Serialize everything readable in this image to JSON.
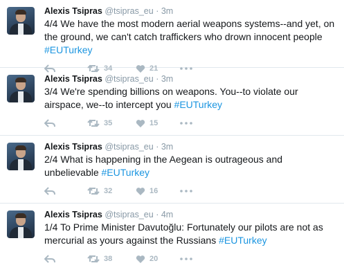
{
  "tweets": [
    {
      "name": "Alexis Tsipras",
      "handle": "@tsipras_eu",
      "separator": "·",
      "time": "3m",
      "text": "4/4 We have the most modern aerial weapons systems--and yet, on the ground, we can't catch traffickers who drown innocent people ",
      "hashtag": "#EUTurkey",
      "retweets": "34",
      "likes": "21"
    },
    {
      "name": "Alexis Tsipras",
      "handle": "@tsipras_eu",
      "separator": "·",
      "time": "3m",
      "text": "3/4 We're spending billions on weapons. You--to violate our airspace, we--to intercept you ",
      "hashtag": "#EUTurkey",
      "retweets": "35",
      "likes": "15"
    },
    {
      "name": "Alexis Tsipras",
      "handle": "@tsipras_eu",
      "separator": "·",
      "time": "3m",
      "text": "2/4 What is happening in the Aegean is outrageous and unbelievable ",
      "hashtag": "#EUTurkey",
      "retweets": "32",
      "likes": "16"
    },
    {
      "name": "Alexis Tsipras",
      "handle": "@tsipras_eu",
      "separator": "·",
      "time": "4m",
      "text": "1/4 To Prime Minister Davutoğlu: Fortunately our pilots are not as mercurial as yours against the Russians ",
      "hashtag": "#EUTurkey",
      "retweets": "38",
      "likes": "20"
    }
  ],
  "icons": {
    "reply": "reply-icon",
    "retweet": "retweet-icon",
    "like": "heart-icon",
    "more": "more-dots-icon"
  },
  "colors": {
    "hashtag": "#1b95e0",
    "muted": "#8899a6",
    "icon": "#aab8c2",
    "divider": "#e1e8ed"
  }
}
